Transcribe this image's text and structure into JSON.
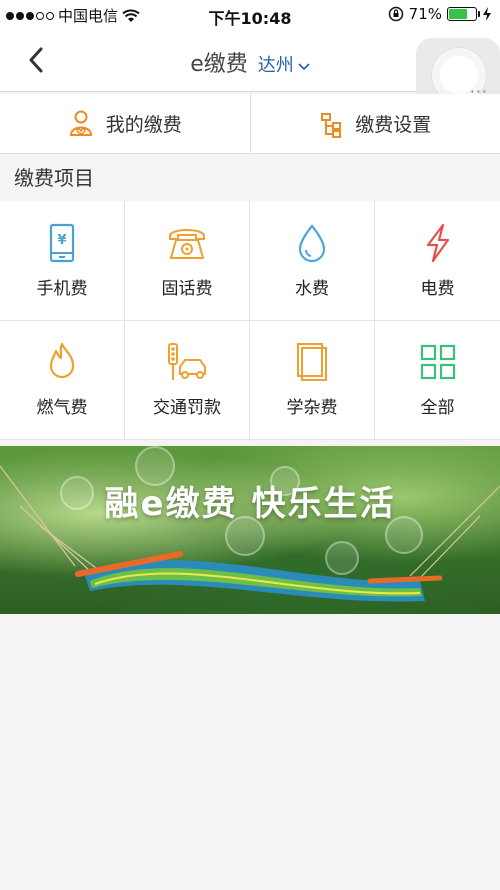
{
  "status_bar": {
    "carrier": "中国电信",
    "time": "下午10:48",
    "battery_percent": "71%",
    "battery_level": 0.71
  },
  "nav": {
    "title": "e缴费",
    "city": "达州",
    "more": "···"
  },
  "actions": [
    {
      "label": "我的缴费",
      "icon": "my-payments-icon",
      "color": "#f08a24"
    },
    {
      "label": "缴费设置",
      "icon": "payment-settings-icon",
      "color": "#f08a24"
    }
  ],
  "section": {
    "title": "缴费项目"
  },
  "services": [
    {
      "label": "手机费",
      "icon": "mobile-phone-icon",
      "color": "#4a9fd8"
    },
    {
      "label": "固话费",
      "icon": "landline-phone-icon",
      "color": "#f0a030"
    },
    {
      "label": "水费",
      "icon": "water-drop-icon",
      "color": "#4aa8e0"
    },
    {
      "label": "电费",
      "icon": "lightning-icon",
      "color": "#e85050"
    },
    {
      "label": "燃气费",
      "icon": "flame-icon",
      "color": "#f0a030"
    },
    {
      "label": "交通罚款",
      "icon": "traffic-icon",
      "color": "#f0a030"
    },
    {
      "label": "学杂费",
      "icon": "book-icon",
      "color": "#f0a030"
    },
    {
      "label": "全部",
      "icon": "grid-icon",
      "color": "#3cbf7a"
    }
  ],
  "banner": {
    "slogan": "融e缴费  快乐生活"
  }
}
